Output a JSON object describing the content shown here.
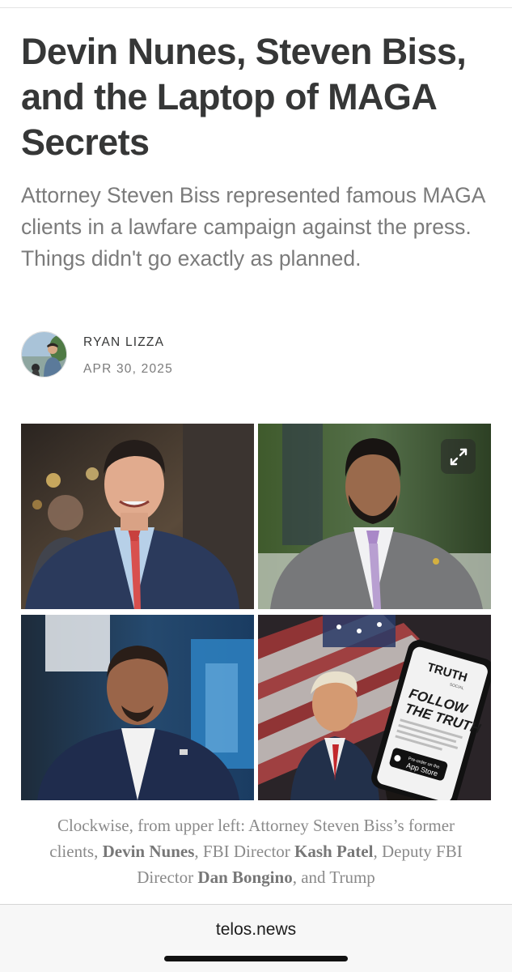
{
  "article": {
    "title": "Devin Nunes, Steven Biss, and the Laptop of MAGA Secrets",
    "subtitle": "Attorney Steven Biss represented famous MAGA clients in a lawfare campaign against the press. Things didn't go exactly as planned.",
    "author": "RYAN LIZZA",
    "date": "APR 30, 2025"
  },
  "gallery": {
    "expand_icon": "expand-arrows-icon",
    "photos": [
      {
        "name": "photo-devin-nunes"
      },
      {
        "name": "photo-kash-patel"
      },
      {
        "name": "photo-dan-bongino"
      },
      {
        "name": "photo-trump-truth-social"
      }
    ],
    "phone_text": {
      "brand": "TRUTH",
      "brand_sub": "SOCIAL",
      "headline_1": "FOLLOW",
      "headline_2": "THE TRUTH",
      "store_small": "Pre-order on the",
      "store_big": "App Store"
    }
  },
  "caption": {
    "p1": "Clockwise, from upper left: Attorney Steven Biss’s former clients, ",
    "b1": "Devin Nunes",
    "p2": ", FBI Director ",
    "b2": "Kash Patel",
    "p3": ", Deputy FBI Director ",
    "b3": "Dan Bongino",
    "p4": ", and Trump"
  },
  "browser": {
    "url": "telos.news"
  },
  "colors": {
    "title": "#363737",
    "subtitle": "#7b7b7b",
    "caption": "#8a8a8a",
    "browser_bar": "#f7f7f7"
  }
}
